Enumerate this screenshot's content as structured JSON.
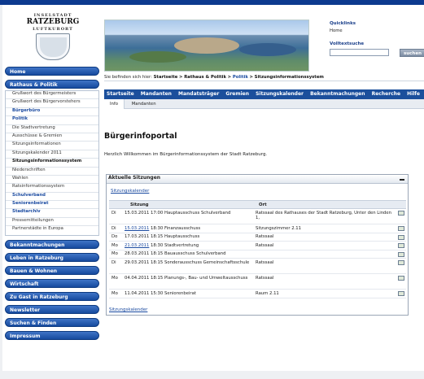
{
  "logo": {
    "line1": "INSELSTADT",
    "line2": "RATZEBURG",
    "line3": "LUFTKURORT"
  },
  "quicklinks": {
    "heading": "Quicklinks",
    "home": "Home"
  },
  "search": {
    "heading": "Volltextsuche",
    "placeholder": "",
    "button": "suchen"
  },
  "breadcrumb": {
    "prefix": "Sie befinden sich hier:",
    "item1": "Startseite",
    "sep": ">",
    "item2": "Rathaus & Politik",
    "item3": "Politik",
    "item4": "Sitzungsinformationssystem"
  },
  "sidebar": {
    "home": "Home",
    "rathaus": "Rathaus & Politik",
    "rathaus_items": [
      "Grußwort des Bürgermeisters",
      "Grußwort des Bürgervorstehers",
      "Bürgerbüro",
      "Politik",
      "Die Stadtvertretung",
      "Ausschüsse & Gremien",
      "Sitzungsinformationen",
      "Sitzungskalender 2011",
      "Sitzungsinformationssystem",
      "Niederschriften",
      "Wahlen",
      "Ratsinformationssystem",
      "Schulverband",
      "Seniorenbeirat",
      "Stadtarchiv",
      "Pressemitteilungen",
      "Partnerstädte in Europa"
    ],
    "sections": [
      "Bekanntmachungen",
      "Leben in Ratzeburg",
      "Bauen & Wohnen",
      "Wirtschaft",
      "Zu Gast in Ratzeburg",
      "Newsletter",
      "Suchen & Finden",
      "Impressum"
    ]
  },
  "topnav": [
    "Startseite",
    "Mandanten",
    "Mandatsträger",
    "Gremien",
    "Sitzungskalender",
    "Bekanntmachungen",
    "Recherche",
    "Hilfe"
  ],
  "subtabs": [
    "Info",
    "Mandanten"
  ],
  "main": {
    "title": "Bürgerinfoportal",
    "welcome": "Herzlich Willkommen im Bürgerinformationssystem der Stadt Ratzeburg."
  },
  "panel": {
    "title": "Aktuelle Sitzungen",
    "link_top": "Sitzungskalender",
    "link_bottom": "Sitzungskalender",
    "col_session": "Sitzung",
    "col_place": "Ort",
    "rows": [
      {
        "day": "Di",
        "date": "15.03.2011",
        "text": "17:00 Hauptausschuss Schulverband",
        "place": "Ratssaal des Rathauses der Stadt Ratzeburg, Unter den Linden 1,",
        "link": false,
        "l2": true,
        "doc": true
      },
      {
        "day": "Di",
        "date": "15.03.2011",
        "text": "18:30 Finanzausschuss",
        "place": "Sitzungszimmer 2.11",
        "link": true,
        "l2": false,
        "doc": true
      },
      {
        "day": "Do",
        "date": "17.03.2011",
        "text": "18:15 Hauptausschuss",
        "place": "Ratssaal",
        "link": false,
        "l2": false,
        "doc": true
      },
      {
        "day": "Mo",
        "date": "21.03.2011",
        "text": "18:30 Stadtvertretung",
        "place": "Ratssaal",
        "link": true,
        "l2": false,
        "doc": true
      },
      {
        "day": "Mo",
        "date": "28.03.2011",
        "text": "18:15 Bauausschuss Schulverband",
        "place": "",
        "link": false,
        "l2": false,
        "doc": true
      },
      {
        "day": "Di",
        "date": "29.03.2011",
        "text": "18:15 Sonderausschuss Gemeinschaftsschule",
        "place": "Ratssaal",
        "link": false,
        "l2": true,
        "doc": true
      },
      {
        "day": "Mo",
        "date": "04.04.2011",
        "text": "18:15 Planungs-, Bau- und Umweltausschuss",
        "place": "Ratssaal",
        "link": false,
        "l2": true,
        "doc": true
      },
      {
        "day": "Mo",
        "date": "11.04.2011",
        "text": "15:30 Seniorenbeirat",
        "place": "Raum 2.11",
        "link": false,
        "l2": false,
        "doc": true
      }
    ]
  }
}
